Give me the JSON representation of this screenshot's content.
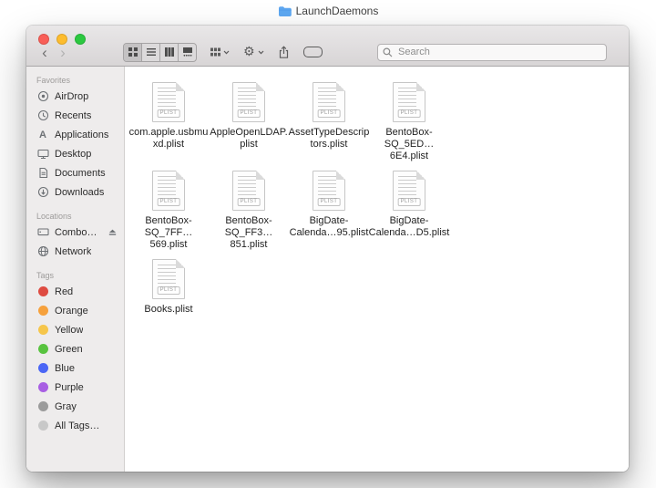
{
  "caption": {
    "title": "LaunchDaemons"
  },
  "toolbar": {
    "back_glyph": "‹",
    "forward_glyph": "›",
    "gear_glyph": "⚙",
    "search_placeholder": "Search"
  },
  "sidebar": {
    "favorites": {
      "label": "Favorites",
      "items": [
        "AirDrop",
        "Recents",
        "Applications",
        "Desktop",
        "Documents",
        "Downloads"
      ]
    },
    "locations": {
      "label": "Locations",
      "items": [
        "Combo…",
        "Network"
      ]
    },
    "tags": {
      "label": "Tags",
      "items": [
        {
          "name": "Red",
          "color": "#de4b41"
        },
        {
          "name": "Orange",
          "color": "#f6a13c"
        },
        {
          "name": "Yellow",
          "color": "#f6c64b"
        },
        {
          "name": "Green",
          "color": "#58c33f"
        },
        {
          "name": "Blue",
          "color": "#4b66f5"
        },
        {
          "name": "Purple",
          "color": "#a85fe3"
        },
        {
          "name": "Gray",
          "color": "#9b9b9b"
        },
        {
          "name": "All Tags…",
          "color": "#c8c8c8"
        }
      ]
    }
  },
  "files": [
    {
      "label": "com.apple.usbmu\nxd.plist",
      "badge": "PLIST"
    },
    {
      "label": "AppleOpenLDAP.\nplist",
      "badge": "PLIST"
    },
    {
      "label": "AssetTypeDescrip\ntors.plist",
      "badge": "PLIST"
    },
    {
      "label": "BentoBox-\nSQ_5ED…6E4.plist",
      "badge": "PLIST"
    },
    {
      "label": "BentoBox-\nSQ_7FF…569.plist",
      "badge": "PLIST"
    },
    {
      "label": "BentoBox-\nSQ_FF3…851.plist",
      "badge": "PLIST"
    },
    {
      "label": "BigDate-\nCalenda…95.plist",
      "badge": "PLIST"
    },
    {
      "label": "BigDate-\nCalenda…D5.plist",
      "badge": "PLIST"
    },
    {
      "label": "Books.plist",
      "badge": "PLIST"
    }
  ]
}
